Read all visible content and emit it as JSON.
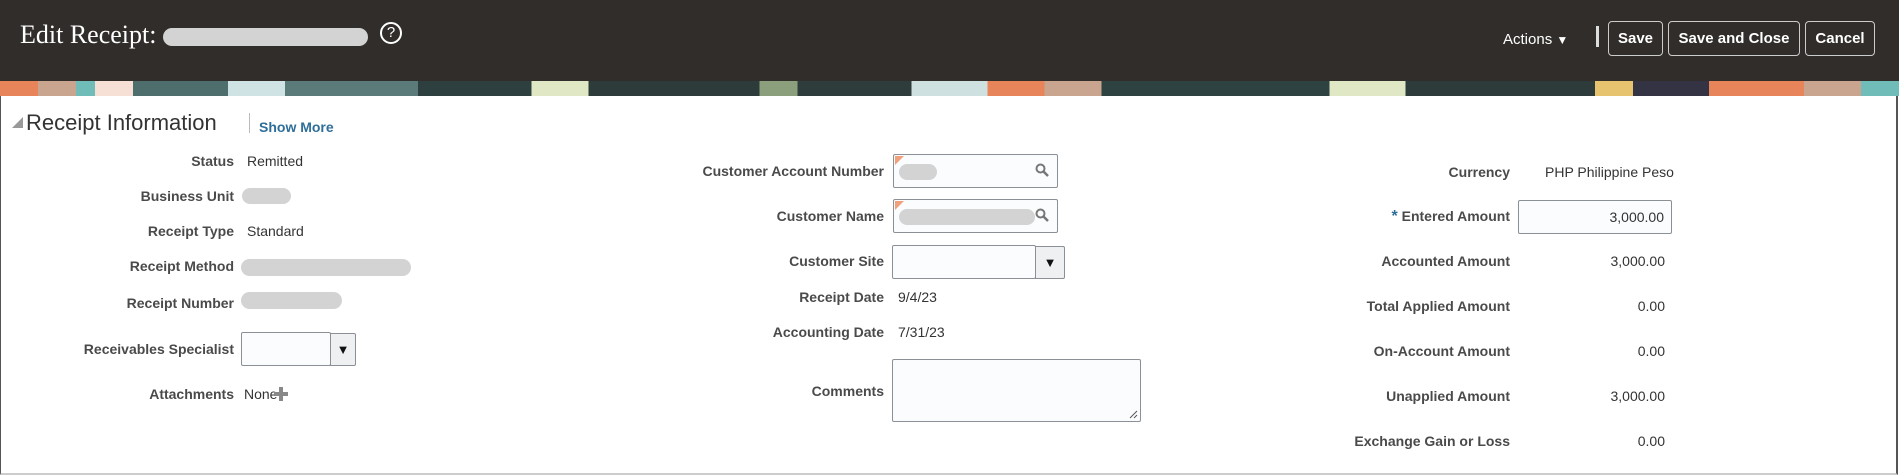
{
  "header": {
    "title": "Edit Receipt:",
    "help_icon": "?",
    "actions_label": "Actions",
    "save": "Save",
    "save_close": "Save and Close",
    "cancel": "Cancel"
  },
  "section": {
    "title": "Receipt Information",
    "show_more": "Show More"
  },
  "left": {
    "status_label": "Status",
    "status": "Remitted",
    "business_unit_label": "Business Unit",
    "receipt_type_label": "Receipt Type",
    "receipt_type": "Standard",
    "receipt_method_label": "Receipt Method",
    "receipt_number_label": "Receipt Number",
    "specialist_label": "Receivables Specialist",
    "attachments_label": "Attachments",
    "attachments": "None"
  },
  "middle": {
    "account_label": "Customer Account Number",
    "name_label": "Customer Name",
    "site_label": "Customer Site",
    "receipt_date_label": "Receipt Date",
    "receipt_date": "9/4/23",
    "accounting_date_label": "Accounting Date",
    "accounting_date": "7/31/23",
    "comments_label": "Comments"
  },
  "right": {
    "currency_label": "Currency",
    "currency": "PHP Philippine Peso",
    "required_mark": "*",
    "entered_label": "Entered Amount",
    "entered": "3,000.00",
    "accounted_label": "Accounted Amount",
    "accounted": "3,000.00",
    "applied_label": "Total Applied Amount",
    "applied": "0.00",
    "onaccount_label": "On-Account Amount",
    "onaccount": "0.00",
    "unapplied_label": "Unapplied Amount",
    "unapplied": "3,000.00",
    "exchange_label": "Exchange Gain or Loss",
    "exchange": "0.00"
  }
}
